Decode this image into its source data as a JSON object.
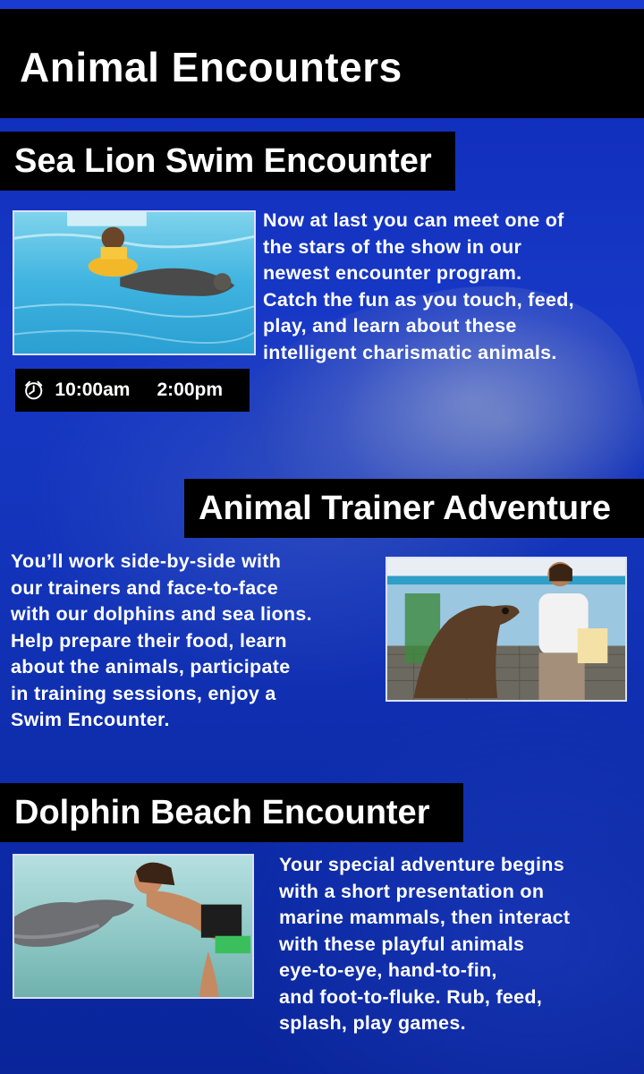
{
  "header": {
    "title": "Animal Encounters"
  },
  "sections": [
    {
      "title": "Sea Lion Swim Encounter",
      "description_lines": [
        "Now at last you can meet one of",
        "the stars of the show in our",
        "newest encounter program.",
        "Catch the fun as you touch, feed,",
        "play, and learn about these",
        "intelligent charismatic animals."
      ],
      "times": [
        "10:00am",
        "2:00pm"
      ],
      "icon": "clock-icon"
    },
    {
      "title": "Animal Trainer Adventure",
      "description_lines": [
        "You’ll work side-by-side with",
        "our trainers and face-to-face",
        "with our dolphins and sea lions.",
        "Help prepare their food, learn",
        "about the animals, participate",
        "in training sessions, enjoy a",
        "Swim Encounter."
      ]
    },
    {
      "title": "Dolphin Beach Encounter",
      "description_lines": [
        "Your special adventure begins",
        "with a short presentation on",
        "marine mammals, then interact",
        "with these playful animals",
        "eye-to-eye, hand-to-fin,",
        "and foot-to-fluke.  Rub, feed,",
        "splash, play games."
      ]
    }
  ],
  "colors": {
    "background": "#1233b8",
    "band": "#000000",
    "text": "#ffffff"
  }
}
